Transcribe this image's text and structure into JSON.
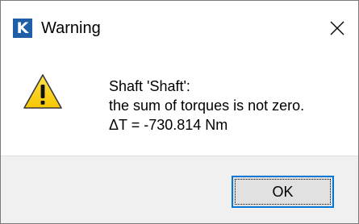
{
  "window": {
    "title": "Warning",
    "app_icon_letter": "K",
    "accent_color": "#1f5fa8",
    "close_glyph": "close-icon"
  },
  "message": {
    "icon": "warning-icon",
    "lines": [
      "Shaft 'Shaft':",
      "the sum of torques is not zero.",
      "ΔT = -730.814 Nm"
    ]
  },
  "buttons": {
    "ok_label": "OK",
    "focus_color": "#0078d7"
  }
}
